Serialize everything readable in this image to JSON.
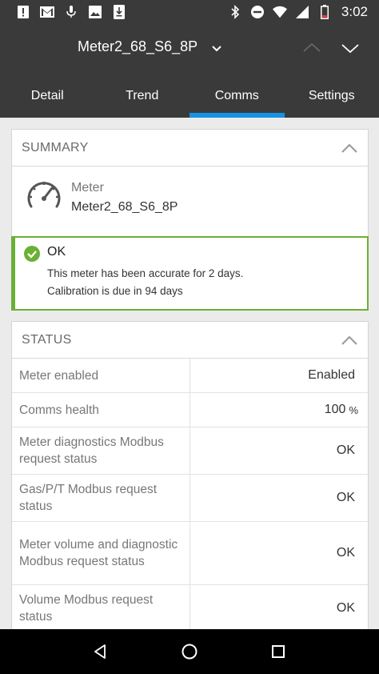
{
  "status_bar": {
    "time": "3:02",
    "left_icons": [
      "alert-icon",
      "gmail-icon",
      "microphone-icon",
      "image-icon",
      "download-icon"
    ],
    "right_icons": [
      "bluetooth-icon",
      "do-not-disturb-icon",
      "wifi-icon",
      "signal-icon",
      "battery-icon"
    ]
  },
  "header": {
    "device_title": "Meter2_68_S6_8P"
  },
  "tabs": [
    {
      "label": "Detail",
      "active": false
    },
    {
      "label": "Trend",
      "active": false
    },
    {
      "label": "Comms",
      "active": true
    },
    {
      "label": "Settings",
      "active": false
    }
  ],
  "summary": {
    "title": "SUMMARY",
    "meter_type": "Meter",
    "meter_name": "Meter2_68_S6_8P",
    "status_title": "OK",
    "status_line1": "This meter has been accurate for 2 days.",
    "status_line2": "Calibration is due in 94 days"
  },
  "status": {
    "title": "STATUS",
    "rows": [
      {
        "label": "Meter enabled",
        "value": "Enabled",
        "unit": ""
      },
      {
        "label": "Comms health",
        "value": "100",
        "unit": "%"
      },
      {
        "label": "Meter diagnostics Modbus request status",
        "value": "OK",
        "unit": ""
      },
      {
        "label": "Gas/P/T Modbus request status",
        "value": "OK",
        "unit": ""
      },
      {
        "label": "Meter volume and diagnostic Modbus request status",
        "value": "OK",
        "unit": ""
      },
      {
        "label": "Volume Modbus request status",
        "value": "OK",
        "unit": ""
      }
    ]
  },
  "colors": {
    "header_bg": "#3a3a3a",
    "tab_indicator": "#1792e5",
    "ok_green": "#6ab035"
  }
}
